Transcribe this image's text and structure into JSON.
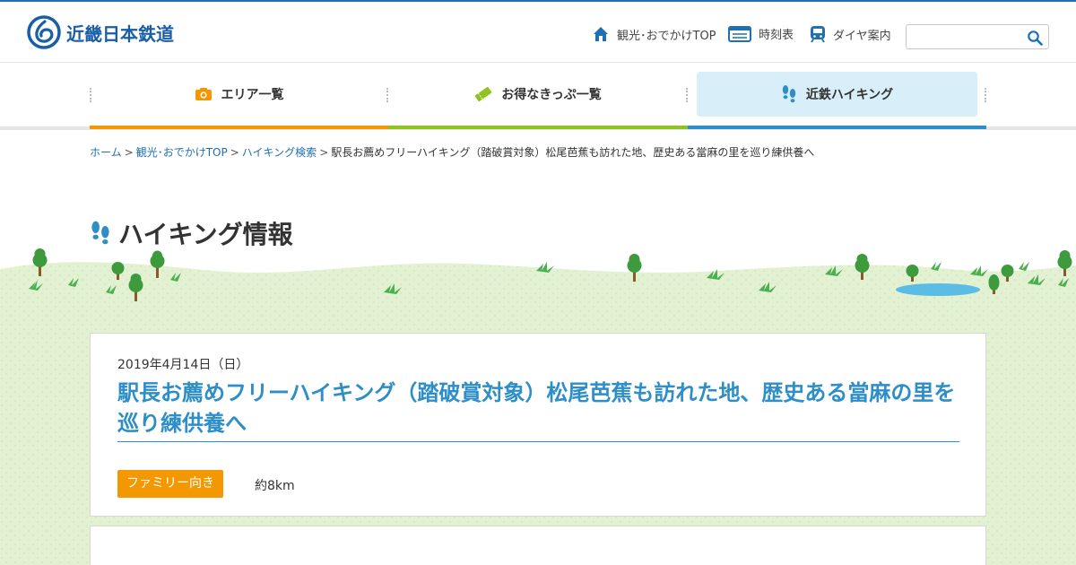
{
  "site": {
    "logo_text": "近畿日本鉄道"
  },
  "utility_nav": [
    {
      "label": "観光･おでかけTOP",
      "icon": "home-icon"
    },
    {
      "label": "時刻表",
      "icon": "timetable-icon"
    },
    {
      "label": "ダイヤ案内",
      "icon": "train-icon"
    }
  ],
  "search": {
    "value": "",
    "placeholder": ""
  },
  "global_nav": [
    {
      "label": "エリア一覧",
      "icon": "camera-icon"
    },
    {
      "label": "お得なきっぷ一覧",
      "icon": "ticket-icon"
    },
    {
      "label": "近鉄ハイキング",
      "icon": "footprints-icon",
      "active": true
    }
  ],
  "breadcrumb": {
    "items": [
      "ホーム",
      "観光･おでかけTOP",
      "ハイキング検索"
    ],
    "separator": ">",
    "current": "駅長お薦めフリーハイキング（踏破賞対象）松尾芭蕉も訪れた地、歴史ある當麻の里を巡り練供養へ"
  },
  "page": {
    "title": "ハイキング情報"
  },
  "event": {
    "date": "2019年4月14日（日）",
    "title": "駅長お薦めフリーハイキング（踏破賞対象）松尾芭蕉も訪れた地、歴史ある當麻の里を巡り練供養へ",
    "tag": "ファミリー向き",
    "distance": "約8km"
  },
  "colors": {
    "brand_blue": "#1a5ea8",
    "accent_blue": "#2d8ec8",
    "orange": "#f39800",
    "green": "#8fc31f",
    "active_nav_bg": "#d8eef9",
    "landscape_green": "#e3f1d3"
  }
}
